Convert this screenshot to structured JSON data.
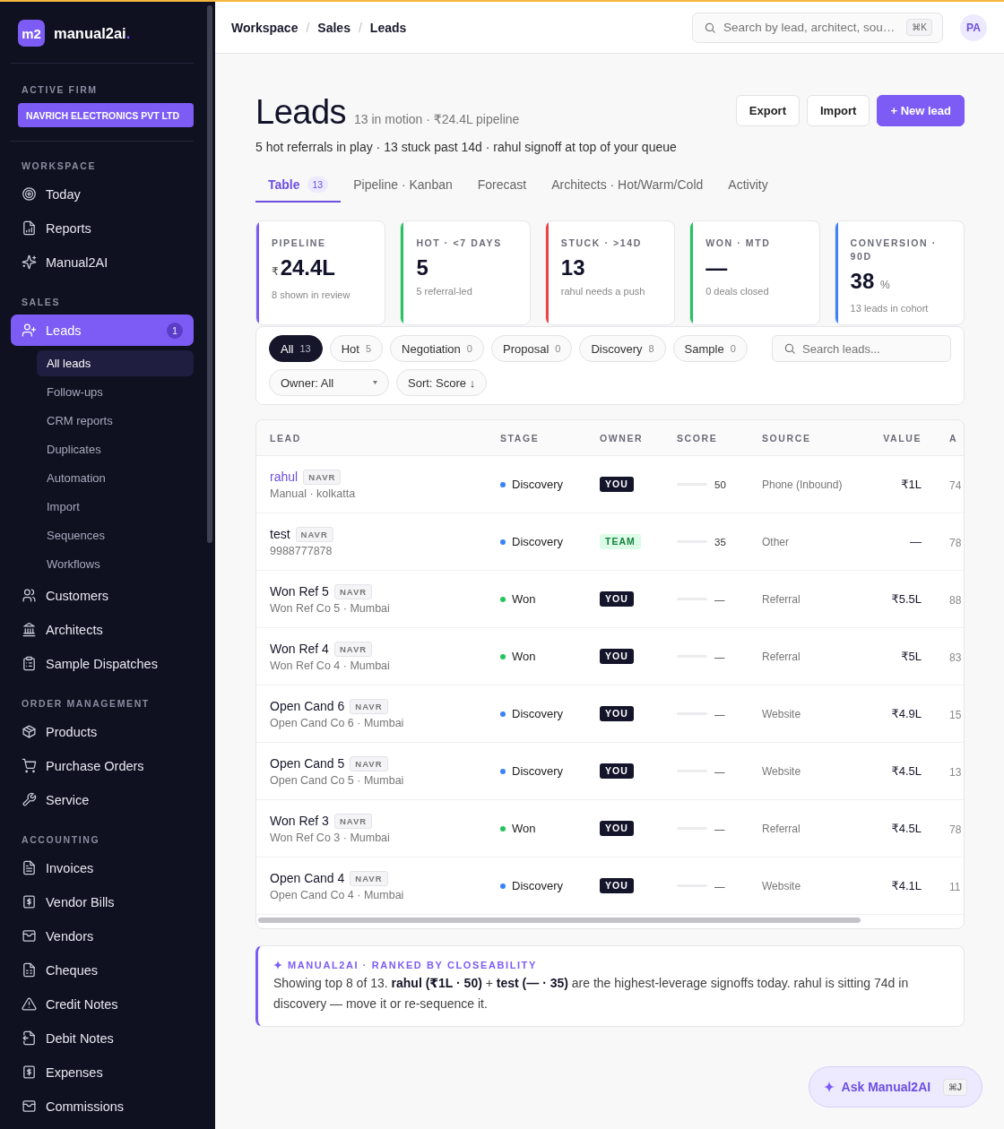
{
  "sidebar": {
    "logo": {
      "mark": "m2",
      "name": "manual2ai",
      "accent": "."
    },
    "firm": {
      "label": "ACTIVE FIRM",
      "name": "NAVRICH ELECTRONICS PVT LTD"
    },
    "sections": [
      {
        "title": "WORKSPACE",
        "items": [
          {
            "label": "Today",
            "selected": false
          },
          {
            "label": "Reports",
            "selected": false
          },
          {
            "label": "Manual2AI",
            "selected": false
          }
        ]
      },
      {
        "title": "SALES",
        "items": [
          {
            "label": "Leads",
            "selected": true,
            "badge": "1",
            "children": [
              {
                "label": "All leads",
                "selected": true
              },
              {
                "label": "Follow-ups",
                "selected": false
              },
              {
                "label": "CRM reports",
                "selected": false
              },
              {
                "label": "Duplicates",
                "selected": false
              },
              {
                "label": "Automation",
                "selected": false
              },
              {
                "label": "Import",
                "selected": false
              },
              {
                "label": "Sequences",
                "selected": false
              },
              {
                "label": "Workflows",
                "selected": false
              }
            ]
          },
          {
            "label": "Customers",
            "selected": false
          },
          {
            "label": "Architects",
            "selected": false
          },
          {
            "label": "Sample Dispatches",
            "selected": false
          }
        ]
      },
      {
        "title": "ORDER MANAGEMENT",
        "items": [
          {
            "label": "Products",
            "selected": false
          },
          {
            "label": "Purchase Orders",
            "selected": false
          },
          {
            "label": "Service",
            "selected": false
          }
        ]
      },
      {
        "title": "ACCOUNTING",
        "items": [
          {
            "label": "Invoices",
            "selected": false
          },
          {
            "label": "Vendor Bills",
            "selected": false
          },
          {
            "label": "Vendors",
            "selected": false
          },
          {
            "label": "Cheques",
            "selected": false
          },
          {
            "label": "Credit Notes",
            "selected": false
          },
          {
            "label": "Debit Notes",
            "selected": false
          },
          {
            "label": "Expenses",
            "selected": false
          },
          {
            "label": "Commissions",
            "selected": false
          }
        ]
      }
    ]
  },
  "header": {
    "breadcrumb": {
      "separator": "/",
      "items": [
        "Workspace",
        "Sales",
        "Leads"
      ]
    },
    "search": {
      "placeholder": "Search by lead, architect, sou…",
      "shortcut": "⌘K"
    },
    "avatar": "PA"
  },
  "page": {
    "title": "Leads",
    "subtitle": "13 in motion · ₹24.4L pipeline",
    "summary": "5 hot referrals in play · 13 stuck past 14d · rahul signoff at top of your queue",
    "actions": [
      {
        "label": "Export",
        "kind": "secondary"
      },
      {
        "label": "Import",
        "kind": "secondary"
      },
      {
        "label": "+ New lead",
        "kind": "primary"
      }
    ]
  },
  "tabs": [
    {
      "label": "Table",
      "count": "13",
      "selected": true
    },
    {
      "label": "Pipeline · Kanban",
      "selected": false
    },
    {
      "label": "Forecast",
      "selected": false
    },
    {
      "label": "Architects · Hot/Warm/Cold",
      "selected": false
    },
    {
      "label": "Activity",
      "selected": false
    }
  ],
  "kpis": [
    {
      "label": "PIPELINE",
      "prefix": "₹",
      "value": "24.4L",
      "note": "8 shown in review",
      "color": "#7c5cf5"
    },
    {
      "label": "HOT · <7 DAYS",
      "value": "5",
      "note": "5 referral-led",
      "color": "#22c55e"
    },
    {
      "label": "STUCK · >14D",
      "value": "13",
      "note": "rahul needs a push",
      "color": "#ef4444"
    },
    {
      "label": "WON · MTD",
      "value": "—",
      "note": "0 deals closed",
      "color": "#22c55e"
    },
    {
      "label": "CONVERSION · 90D",
      "value": "38",
      "suffix": "%",
      "note": "13 leads in cohort",
      "color": "#3b82f6"
    }
  ],
  "filters": {
    "chips": [
      {
        "label": "All",
        "count": "13",
        "selected": true
      },
      {
        "label": "Hot",
        "count": "5",
        "selected": false
      },
      {
        "label": "Negotiation",
        "count": "0",
        "selected": false
      },
      {
        "label": "Proposal",
        "count": "0",
        "selected": false
      },
      {
        "label": "Discovery",
        "count": "8",
        "selected": false
      },
      {
        "label": "Sample",
        "count": "0",
        "selected": false
      }
    ],
    "search": {
      "placeholder": "Search leads..."
    },
    "owner": {
      "label": "Owner: All"
    },
    "sort": {
      "label": "Sort: Score ↓"
    }
  },
  "table": {
    "columns": [
      "LEAD",
      "STAGE",
      "OWNER",
      "SCORE",
      "SOURCE",
      "VALUE",
      "A"
    ],
    "rows": [
      {
        "lead": "rahul",
        "tag": "NAVR",
        "detail": "Manual · kolkatta",
        "highlighted": true,
        "stage": {
          "label": "Discovery",
          "color": "#3b82f6"
        },
        "owner": {
          "label": "YOU",
          "kind": "you"
        },
        "score": "50",
        "source": "Phone (Inbound)",
        "value": "₹1L",
        "column_7": "74"
      },
      {
        "lead": "test",
        "tag": "NAVR",
        "detail": "9988777878",
        "highlighted": false,
        "stage": {
          "label": "Discovery",
          "color": "#3b82f6"
        },
        "owner": {
          "label": "TEAM",
          "kind": "team"
        },
        "score": "35",
        "source": "Other",
        "value": "—",
        "column_7": "78"
      },
      {
        "lead": "Won Ref 5",
        "tag": "NAVR",
        "detail": "Won Ref Co 5 · Mumbai",
        "highlighted": false,
        "stage": {
          "label": "Won",
          "color": "#22c55e"
        },
        "owner": {
          "label": "YOU",
          "kind": "you"
        },
        "score": "—",
        "source": "Referral",
        "value": "₹5.5L",
        "column_7": "88"
      },
      {
        "lead": "Won Ref 4",
        "tag": "NAVR",
        "detail": "Won Ref Co 4 · Mumbai",
        "highlighted": false,
        "stage": {
          "label": "Won",
          "color": "#22c55e"
        },
        "owner": {
          "label": "YOU",
          "kind": "you"
        },
        "score": "—",
        "source": "Referral",
        "value": "₹5L",
        "column_7": "83"
      },
      {
        "lead": "Open Cand 6",
        "tag": "NAVR",
        "detail": "Open Cand Co 6 · Mumbai",
        "highlighted": false,
        "stage": {
          "label": "Discovery",
          "color": "#3b82f6"
        },
        "owner": {
          "label": "YOU",
          "kind": "you"
        },
        "score": "—",
        "source": "Website",
        "value": "₹4.9L",
        "column_7": "15"
      },
      {
        "lead": "Open Cand 5",
        "tag": "NAVR",
        "detail": "Open Cand Co 5 · Mumbai",
        "highlighted": false,
        "stage": {
          "label": "Discovery",
          "color": "#3b82f6"
        },
        "owner": {
          "label": "YOU",
          "kind": "you"
        },
        "score": "—",
        "source": "Website",
        "value": "₹4.5L",
        "column_7": "13"
      },
      {
        "lead": "Won Ref 3",
        "tag": "NAVR",
        "detail": "Won Ref Co 3 · Mumbai",
        "highlighted": false,
        "stage": {
          "label": "Won",
          "color": "#22c55e"
        },
        "owner": {
          "label": "YOU",
          "kind": "you"
        },
        "score": "—",
        "source": "Referral",
        "value": "₹4.5L",
        "column_7": "78"
      },
      {
        "lead": "Open Cand 4",
        "tag": "NAVR",
        "detail": "Open Cand Co 4 · Mumbai",
        "highlighted": false,
        "stage": {
          "label": "Discovery",
          "color": "#3b82f6"
        },
        "owner": {
          "label": "YOU",
          "kind": "you"
        },
        "score": "—",
        "source": "Website",
        "value": "₹4.1L",
        "column_7": "11"
      }
    ]
  },
  "insight": {
    "label": "MANUAL2AI · RANKED BY CLOSEABILITY",
    "text": "Showing top 8 of 13. **rahul (₹1L · 50)** + **test (— · 35)** are the highest-leverage signoffs today. rahul is sitting 74d in discovery — move it or re-sequence it."
  },
  "assistant": {
    "label": "Ask Manual2AI",
    "shortcut": "⌘J"
  }
}
